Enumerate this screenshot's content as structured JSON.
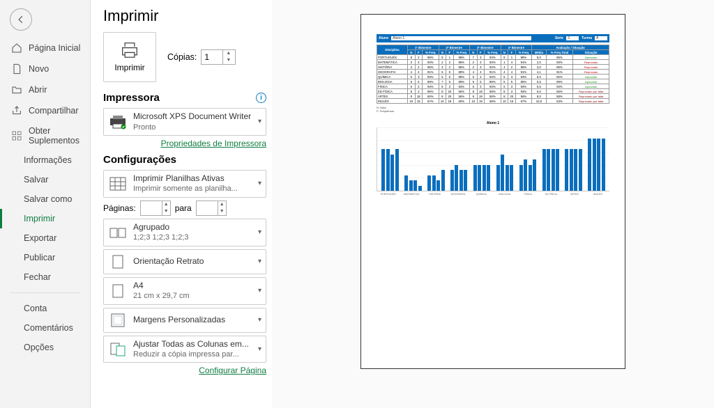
{
  "sidebar": {
    "back": "←",
    "items": [
      {
        "label": "Página Inicial"
      },
      {
        "label": "Novo"
      },
      {
        "label": "Abrir"
      },
      {
        "label": "Compartilhar"
      },
      {
        "label": "Obter Suplementos"
      }
    ],
    "sub": [
      {
        "label": "Informações"
      },
      {
        "label": "Salvar"
      },
      {
        "label": "Salvar como"
      },
      {
        "label": "Imprimir"
      },
      {
        "label": "Exportar"
      },
      {
        "label": "Publicar"
      },
      {
        "label": "Fechar"
      }
    ],
    "footer": [
      {
        "label": "Conta"
      },
      {
        "label": "Comentários"
      },
      {
        "label": "Opções"
      }
    ]
  },
  "print": {
    "title": "Imprimir",
    "button": "Imprimir",
    "copies_label": "Cópias:",
    "copies_value": "1",
    "printer_heading": "Impressora",
    "printer_name": "Microsoft XPS Document Writer",
    "printer_status": "Pronto",
    "printer_props": "Propriedades de Impressora",
    "settings_heading": "Configurações",
    "active_sheets_t1": "Imprimir Planilhas Ativas",
    "active_sheets_t2": "Imprimir somente as planilha...",
    "pages_label": "Páginas:",
    "pages_to": "para",
    "collate_t1": "Agrupado",
    "collate_t2": "1;2;3    1;2;3    1;2;3",
    "orient_t1": "Orientação Retrato",
    "paper_t1": "A4",
    "paper_t2": "21 cm x 29,7 cm",
    "margins_t1": "Margens Personalizadas",
    "scale_t1": "Ajustar Todas as Colunas em...",
    "scale_t2": "Reduzir a cópia impressa par...",
    "page_setup": "Configurar Página"
  },
  "preview": {
    "aluno_lbl": "Aluno",
    "aluno_val": "Aluno 1",
    "serie_lbl": "Série",
    "serie_val": "3",
    "turma_lbl": "Turma",
    "turma_val": "A",
    "disc_h": "Disciplina",
    "bim": [
      "1º Bimestre",
      "2º Bimestre",
      "3º Bimestre",
      "4º Bimestre"
    ],
    "aval_h": "Avaliação / Situação",
    "cols": [
      "N",
      "F",
      "% Freq"
    ],
    "fin_cols": [
      "Média",
      "% Freq Total",
      "Situação"
    ],
    "legend1": "N: Nota",
    "legend2": "F: Frequência",
    "rows": [
      {
        "d": "PORTUGUÊS",
        "v": [
          "8",
          "2",
          "96%",
          "8",
          "1",
          "98%",
          "7",
          "3",
          "93%",
          "8",
          "1",
          "98%"
        ],
        "m": "8,0",
        "f": "96%",
        "s": "Aprovado",
        "c": "green"
      },
      {
        "d": "MATEMÁTICA",
        "v": [
          "3",
          "3",
          "93%",
          "2",
          "2",
          "96%",
          "2",
          "3",
          "93%",
          "1",
          "4",
          "91%"
        ],
        "m": "2,0",
        "f": "93%",
        "s": "Reprovado",
        "c": "red"
      },
      {
        "d": "HISTÓRIA",
        "v": [
          "3",
          "2",
          "96%",
          "3",
          "2",
          "96%",
          "2",
          "3",
          "93%",
          "4",
          "2",
          "96%"
        ],
        "m": "3,0",
        "f": "95%",
        "s": "Reprovado",
        "c": "red"
      },
      {
        "d": "GEOGRAFIA",
        "v": [
          "4",
          "4",
          "91%",
          "5",
          "5",
          "89%",
          "4",
          "4",
          "91%",
          "4",
          "4",
          "91%"
        ],
        "m": "4,1",
        "f": "91%",
        "s": "Reprovado",
        "c": "red"
      },
      {
        "d": "QUÍMICA",
        "v": [
          "5",
          "3",
          "93%",
          "5",
          "5",
          "89%",
          "5",
          "3",
          "93%",
          "5",
          "3",
          "93%"
        ],
        "m": "5,0",
        "f": "92%",
        "s": "Aprovado",
        "c": "green"
      },
      {
        "d": "BIOLOGIA",
        "v": [
          "5",
          "5",
          "89%",
          "7",
          "5",
          "89%",
          "5",
          "5",
          "89%",
          "5",
          "5",
          "89%"
        ],
        "m": "5,5",
        "f": "89%",
        "s": "Aprovado",
        "c": "green"
      },
      {
        "d": "FÍSICA",
        "v": [
          "5",
          "3",
          "93%",
          "6",
          "3",
          "93%",
          "5",
          "3",
          "93%",
          "6",
          "3",
          "93%"
        ],
        "m": "5,5",
        "f": "93%",
        "s": "Aprovado",
        "c": "green"
      },
      {
        "d": "ED FÍSICA",
        "v": [
          "8",
          "2",
          "96%",
          "8",
          "20",
          "56%",
          "8",
          "19",
          "58%",
          "8",
          "3",
          "93%"
        ],
        "m": "5,0",
        "f": "65%",
        "s": "Reprovado por falta",
        "c": "darkred"
      },
      {
        "d": "ARTES",
        "v": [
          "8",
          "18",
          "60%",
          "8",
          "20",
          "56%",
          "8",
          "19",
          "58%",
          "8",
          "20",
          "56%"
        ],
        "m": "8,0",
        "f": "58%",
        "s": "Reprovado por falta",
        "c": "darkred"
      },
      {
        "d": "INGLÊS",
        "v": [
          "10",
          "15",
          "67%",
          "10",
          "18",
          "60%",
          "10",
          "19",
          "58%",
          "10",
          "15",
          "67%"
        ],
        "m": "10,0",
        "f": "63%",
        "s": "Reprovado por falta",
        "c": "darkred"
      }
    ],
    "chart_title": "Aluno 1"
  },
  "chart_data": {
    "type": "bar",
    "title": "Aluno 1",
    "categories": [
      "PORTUGUÊS",
      "MATEMÁTICA",
      "HISTÓRIA",
      "GEOGRAFIA",
      "QUÍMICA",
      "BIOLOGIA",
      "FÍSICA",
      "ED FÍSICA",
      "ARTES",
      "INGLÊS"
    ],
    "series": [
      {
        "name": "1º Bim",
        "values": [
          8,
          3,
          3,
          4,
          5,
          5,
          5,
          8,
          8,
          10
        ]
      },
      {
        "name": "2º Bim",
        "values": [
          8,
          2,
          3,
          5,
          5,
          7,
          6,
          8,
          8,
          10
        ]
      },
      {
        "name": "3º Bim",
        "values": [
          7,
          2,
          2,
          4,
          5,
          5,
          5,
          8,
          8,
          10
        ]
      },
      {
        "name": "4º Bim",
        "values": [
          8,
          1,
          4,
          4,
          5,
          5,
          6,
          8,
          8,
          10
        ]
      }
    ],
    "ylim": [
      0,
      12
    ]
  }
}
